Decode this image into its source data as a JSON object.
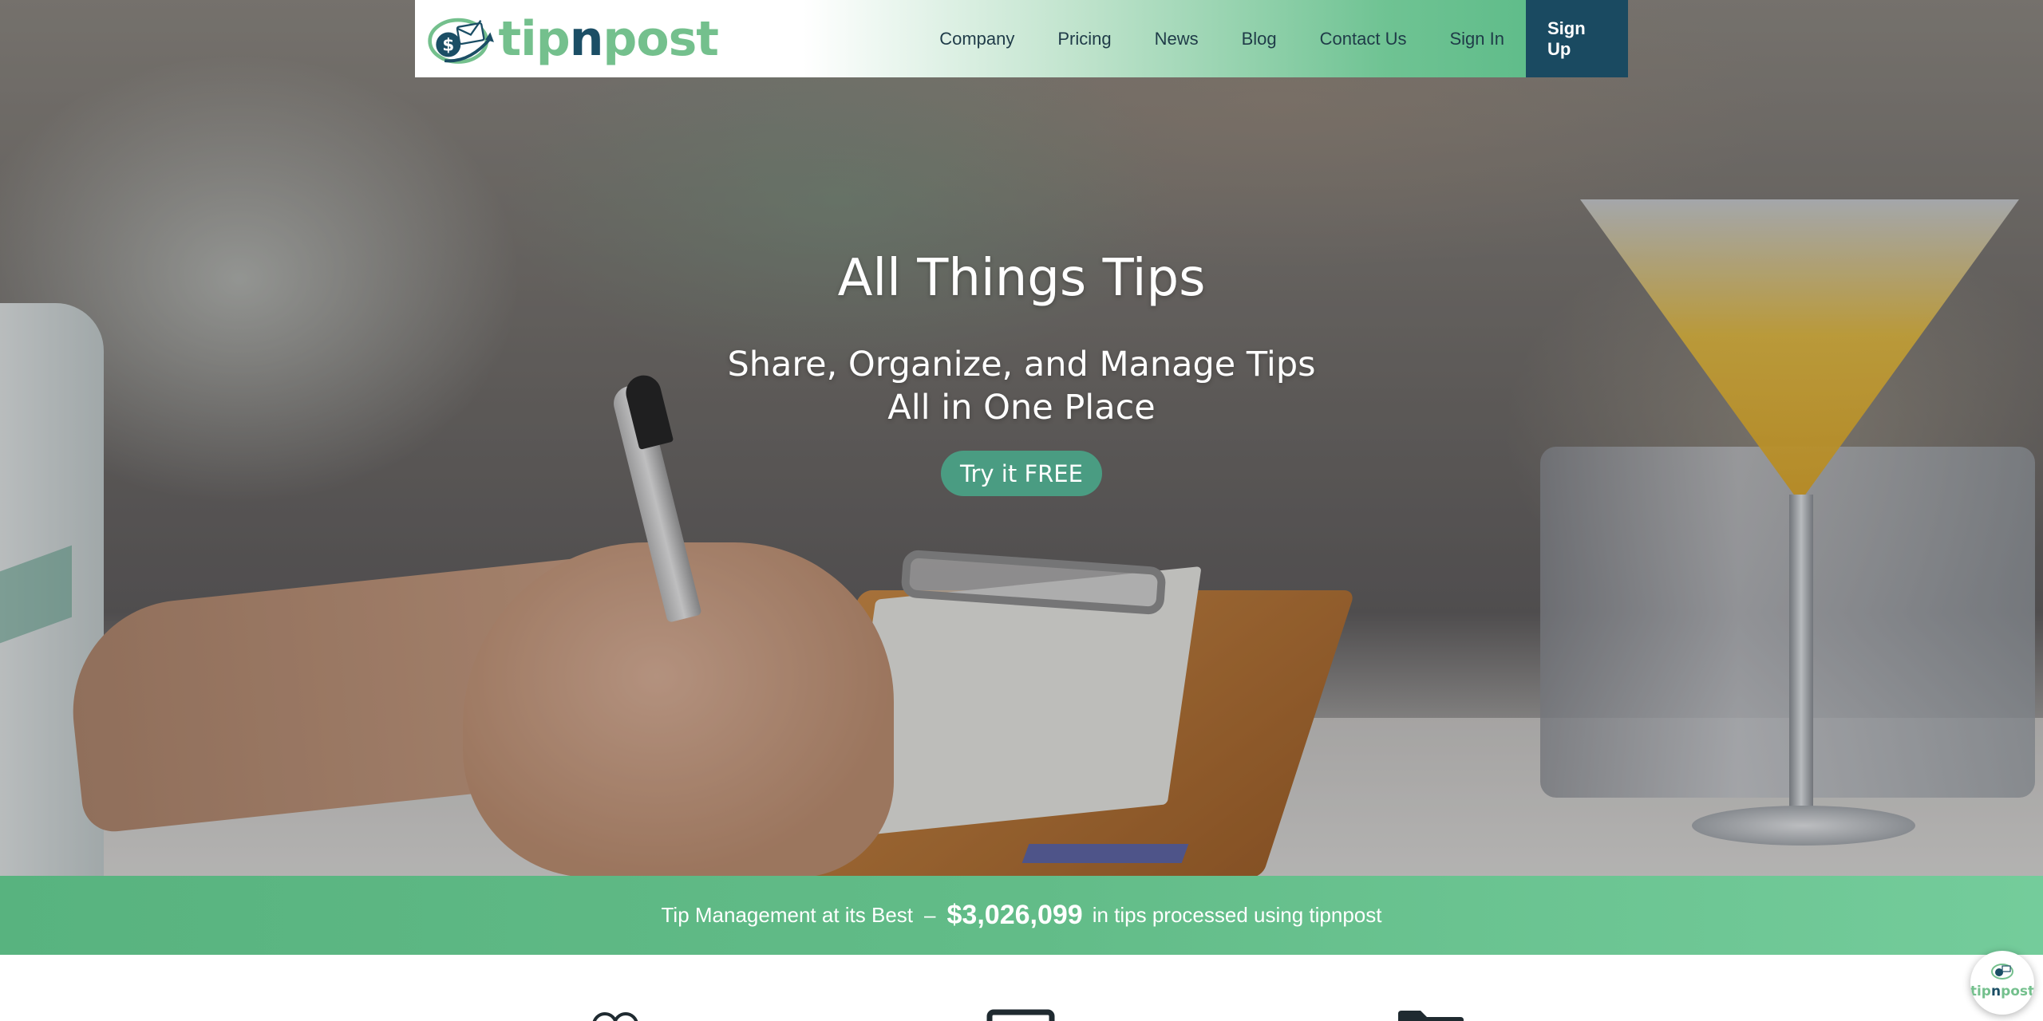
{
  "brand": {
    "logo_text_left": "tip",
    "logo_text_mid": "n",
    "logo_text_right": "post",
    "colors": {
      "green": "#74c08d",
      "navy": "#1a4a61",
      "cta": "#4a9c82",
      "stats_bar": "#62bc88"
    }
  },
  "nav": {
    "items": [
      {
        "label": "Company"
      },
      {
        "label": "Pricing"
      },
      {
        "label": "News"
      },
      {
        "label": "Blog"
      },
      {
        "label": "Contact Us"
      },
      {
        "label": "Sign In"
      }
    ],
    "signup_label": "Sign Up"
  },
  "hero": {
    "title": "All Things Tips",
    "subtitle_line1": "Share, Organize, and Manage Tips",
    "subtitle_line2": "All in One Place",
    "cta_label": "Try it FREE"
  },
  "stats": {
    "lead": "Tip Management at its Best",
    "dash": "–",
    "amount": "$3,026,099",
    "tail": "in tips processed using tipnpost"
  },
  "features": {
    "icons": [
      "people-icon",
      "monitor-icon",
      "folder-icon"
    ]
  },
  "chat": {
    "icon": "tipnpost-chat-icon",
    "mini_left": "tip",
    "mini_mid": "n",
    "mini_right": "post"
  }
}
